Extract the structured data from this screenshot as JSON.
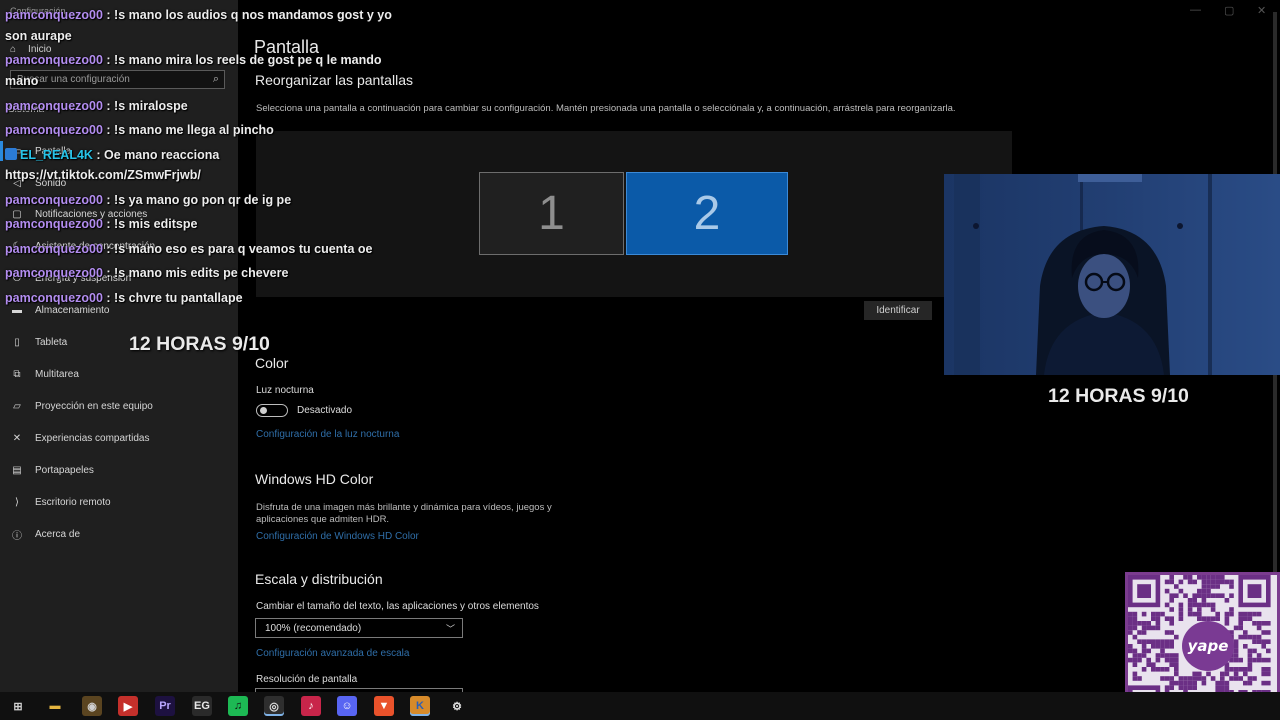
{
  "window": {
    "title": "Configuración",
    "home": "Inicio",
    "search_placeholder": "Buscar una configuración",
    "section": "Sistema",
    "nav": [
      {
        "label": "Pantalla",
        "icon": "monitor-icon",
        "glyph": "▭"
      },
      {
        "label": "Sonido",
        "icon": "speaker-icon",
        "glyph": "◁"
      },
      {
        "label": "Notificaciones y acciones",
        "icon": "notification-icon",
        "glyph": "▢"
      },
      {
        "label": "Asistente de concentración",
        "icon": "moon-icon",
        "glyph": "☾"
      },
      {
        "label": "Energía y suspensión",
        "icon": "power-icon",
        "glyph": "⏻"
      },
      {
        "label": "Almacenamiento",
        "icon": "storage-icon",
        "glyph": "▬"
      },
      {
        "label": "Tableta",
        "icon": "tablet-icon",
        "glyph": "▯"
      },
      {
        "label": "Multitarea",
        "icon": "multitask-icon",
        "glyph": "⧉"
      },
      {
        "label": "Proyección en este equipo",
        "icon": "projection-icon",
        "glyph": "▱"
      },
      {
        "label": "Experiencias compartidas",
        "icon": "shared-icon",
        "glyph": "✕"
      },
      {
        "label": "Portapapeles",
        "icon": "clipboard-icon",
        "glyph": "▤"
      },
      {
        "label": "Escritorio remoto",
        "icon": "remote-desktop-icon",
        "glyph": "⟩"
      },
      {
        "label": "Acerca de",
        "icon": "info-icon",
        "glyph": "ⓘ"
      }
    ]
  },
  "main": {
    "title": "Pantalla",
    "rearrange": {
      "title": "Reorganizar las pantallas",
      "description": "Selecciona una pantalla a continuación para cambiar su configuración. Mantén presionada una pantalla o selecciónala y, a continuación, arrástrela para reorganizarla.",
      "monitor_1": "1",
      "monitor_2": "2",
      "selected": "2",
      "identify": "Identificar"
    },
    "color": {
      "title": "Color",
      "night_light": "Luz nocturna",
      "toggle_state": "Desactivado",
      "night_light_link": "Configuración de la luz nocturna"
    },
    "hdr": {
      "title": "Windows HD Color",
      "description_1": "Disfruta de una imagen más brillante y dinámica para vídeos, juegos y",
      "description_2": "aplicaciones que admiten HDR.",
      "link": "Configuración de Windows HD Color"
    },
    "scale": {
      "title": "Escala y distribución",
      "change_label": "Cambiar el tamaño del texto, las aplicaciones y otros elementos",
      "value": "100% (recomendado)",
      "advanced_link": "Configuración avanzada de escala",
      "resolution_label": "Resolución de pantalla"
    }
  },
  "chat": [
    {
      "user": "pamconquezo00",
      "text": " : !s mano los audios q nos mandamos gost y yo"
    },
    {
      "user": "",
      "text": "son aurape"
    },
    {
      "user": "pamconquezo00",
      "text": " : !s mano mira los reels de gost pe q le mando"
    },
    {
      "user": "",
      "text": "mano"
    },
    {
      "user": "pamconquezo00",
      "text": " : !s miralospe"
    },
    {
      "user": "pamconquezo00",
      "text": " : !s mano me llega al pincho"
    },
    {
      "user": "EL_REAL4K",
      "text": " : Oe mano reacciona",
      "badge": true
    },
    {
      "user": "",
      "text": "https://vt.tiktok.com/ZSmwFrjwb/"
    },
    {
      "user": "pamconquezo00",
      "text": " : !s ya mano go pon qr de ig pe"
    },
    {
      "user": "pamconquezo00",
      "text": " : !s mis editspe"
    },
    {
      "user": "pamconquezo00",
      "text": " : !s mano eso es para q veamos tu cuenta oe"
    },
    {
      "user": "pamconquezo00",
      "text": " : !s mano mis edits pe chevere"
    },
    {
      "user": "pamconquezo00",
      "text": " : !s chvre tu pantallape"
    }
  ],
  "overlay": {
    "text_left": "12 HORAS 9/10",
    "text_right": "12 HORAS 9/10"
  },
  "qr": {
    "brand": "yape"
  },
  "taskbar": {
    "apps": [
      {
        "name": "start-icon",
        "glyph": "⊞",
        "color": "#d0d0d0",
        "bg": "transparent"
      },
      {
        "name": "file-explorer-icon",
        "glyph": "▬",
        "color": "#e6b640",
        "bg": "transparent"
      },
      {
        "name": "obs-icon",
        "glyph": "◉",
        "color": "#cfcfcf",
        "bg": "#5a4420"
      },
      {
        "name": "youtube-icon",
        "glyph": "▶",
        "color": "#ffffff",
        "bg": "#c4302b"
      },
      {
        "name": "premiere-icon",
        "glyph": "Pr",
        "color": "#b9a6ff",
        "bg": "#1d1140"
      },
      {
        "name": "epic-games-icon",
        "glyph": "EG",
        "color": "#e8e8e8",
        "bg": "#2a2a2a"
      },
      {
        "name": "spotify-icon",
        "glyph": "♫",
        "color": "#111111",
        "bg": "#1db954"
      },
      {
        "name": "steam-icon",
        "glyph": "◎",
        "color": "#dddddd",
        "bg": "#2e2e2e"
      },
      {
        "name": "tiktok-icon",
        "glyph": "♪",
        "color": "#ffffff",
        "bg": "#c8254a"
      },
      {
        "name": "discord-icon",
        "glyph": "☺",
        "color": "#ffffff",
        "bg": "#5865f2"
      },
      {
        "name": "brave-icon",
        "glyph": "▼",
        "color": "#ffffff",
        "bg": "#e9522b"
      },
      {
        "name": "kodi-icon",
        "glyph": "K",
        "color": "#2a5fb8",
        "bg": "#d68a2a"
      },
      {
        "name": "settings-icon",
        "glyph": "⚙",
        "color": "#e0e0e0",
        "bg": "transparent"
      }
    ]
  },
  "colors": {
    "accent": "#0b5aa8",
    "chat_user": "#b38df0",
    "link": "#2f6ea8",
    "yape_purple": "#7a3a93"
  }
}
